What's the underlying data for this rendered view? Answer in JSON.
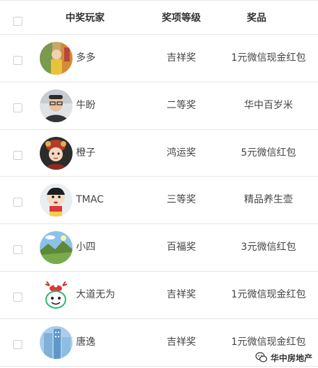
{
  "header": {
    "player": "中奖玩家",
    "level": "奖项等级",
    "prize": "奖品"
  },
  "rows": [
    {
      "name": "多多",
      "level": "吉祥奖",
      "prize": "1元微信现金红包"
    },
    {
      "name": "牛盼",
      "level": "二等奖",
      "prize": "华中百岁米"
    },
    {
      "name": "橙子",
      "level": "鸿运奖",
      "prize": "5元微信红包"
    },
    {
      "name": "TMAC",
      "level": "三等奖",
      "prize": "精品养生壶"
    },
    {
      "name": "小四",
      "level": "百福奖",
      "prize": "3元微信红包"
    },
    {
      "name": "大道无为",
      "level": "吉祥奖",
      "prize": "1元微信现金红包"
    },
    {
      "name": "唐逸",
      "level": "吉祥奖",
      "prize": "1元微信现金红包"
    }
  ],
  "watermark": {
    "text": "华中房地产",
    "icon": "wechat-icon"
  }
}
